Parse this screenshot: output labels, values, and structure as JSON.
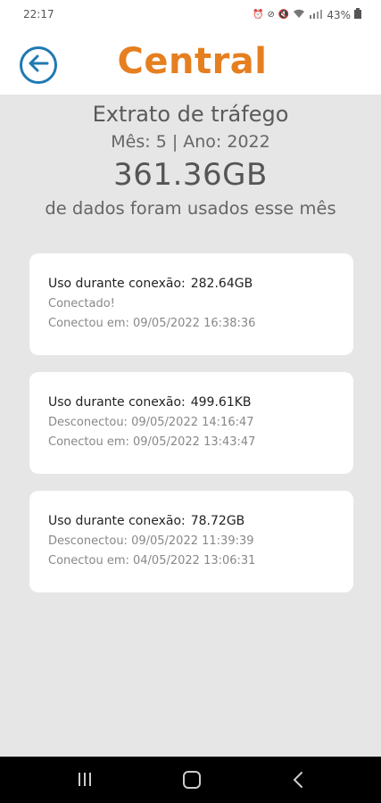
{
  "status": {
    "time": "22:17",
    "battery": "43%",
    "icons": [
      "alarm-icon",
      "dnd-icon",
      "volume-icon",
      "wifi-icon",
      "signal-icon",
      "battery-icon"
    ]
  },
  "header": {
    "title": "Central",
    "back_icon": "arrow-left-icon",
    "brand_color": "#e57f20",
    "accent_color": "#1f79b3"
  },
  "summary": {
    "title": "Extrato de tráfego",
    "period": "Mês: 5 | Ano: 2022",
    "total": "361.36GB",
    "description": "de dados foram usados esse mês"
  },
  "sessions": [
    {
      "usage_label": "Uso durante conexão:",
      "usage_value": "282.64GB",
      "line1": "Conectado!",
      "line2": "Conectou em: 09/05/2022 16:38:36"
    },
    {
      "usage_label": "Uso durante conexão:",
      "usage_value": "499.61KB",
      "line1": "Desconectou: 09/05/2022 14:16:47",
      "line2": "Conectou em: 09/05/2022 13:43:47"
    },
    {
      "usage_label": "Uso durante conexão:",
      "usage_value": "78.72GB",
      "line1": "Desconectou: 09/05/2022 11:39:39",
      "line2": "Conectou em: 04/05/2022 13:06:31"
    }
  ],
  "nav": {
    "recents_icon": "recents-icon",
    "home_icon": "home-icon",
    "back_icon": "back-icon"
  }
}
